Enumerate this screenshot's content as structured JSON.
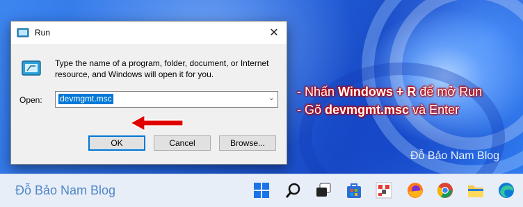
{
  "run_dialog": {
    "title": "Run",
    "description": "Type the name of a program, folder, document, or Internet resource, and Windows will open it for you.",
    "open_label": "Open:",
    "open_value": "devmgmt.msc",
    "buttons": {
      "ok": "OK",
      "cancel": "Cancel",
      "browse": "Browse..."
    }
  },
  "annotations": {
    "line1": {
      "prefix": "- Nhấn ",
      "bold": "Windows + R",
      "suffix": " để mở Run"
    },
    "line2": {
      "prefix": "- Gõ ",
      "bold": "devmgmt.msc",
      "suffix": " và Enter"
    }
  },
  "watermark_desktop": "Đỗ Bảo Nam Blog",
  "taskbar": {
    "watermark": "Đỗ Bảo Nam Blog",
    "icons": [
      "start-icon",
      "search-icon",
      "task-view-icon",
      "store-icon",
      "paint-icon",
      "firefox-icon",
      "chrome-icon",
      "file-explorer-icon",
      "edge-icon"
    ]
  },
  "colors": {
    "accent": "#0078d7",
    "annotation_outline": "#c00000",
    "arrow": "#e00000"
  }
}
